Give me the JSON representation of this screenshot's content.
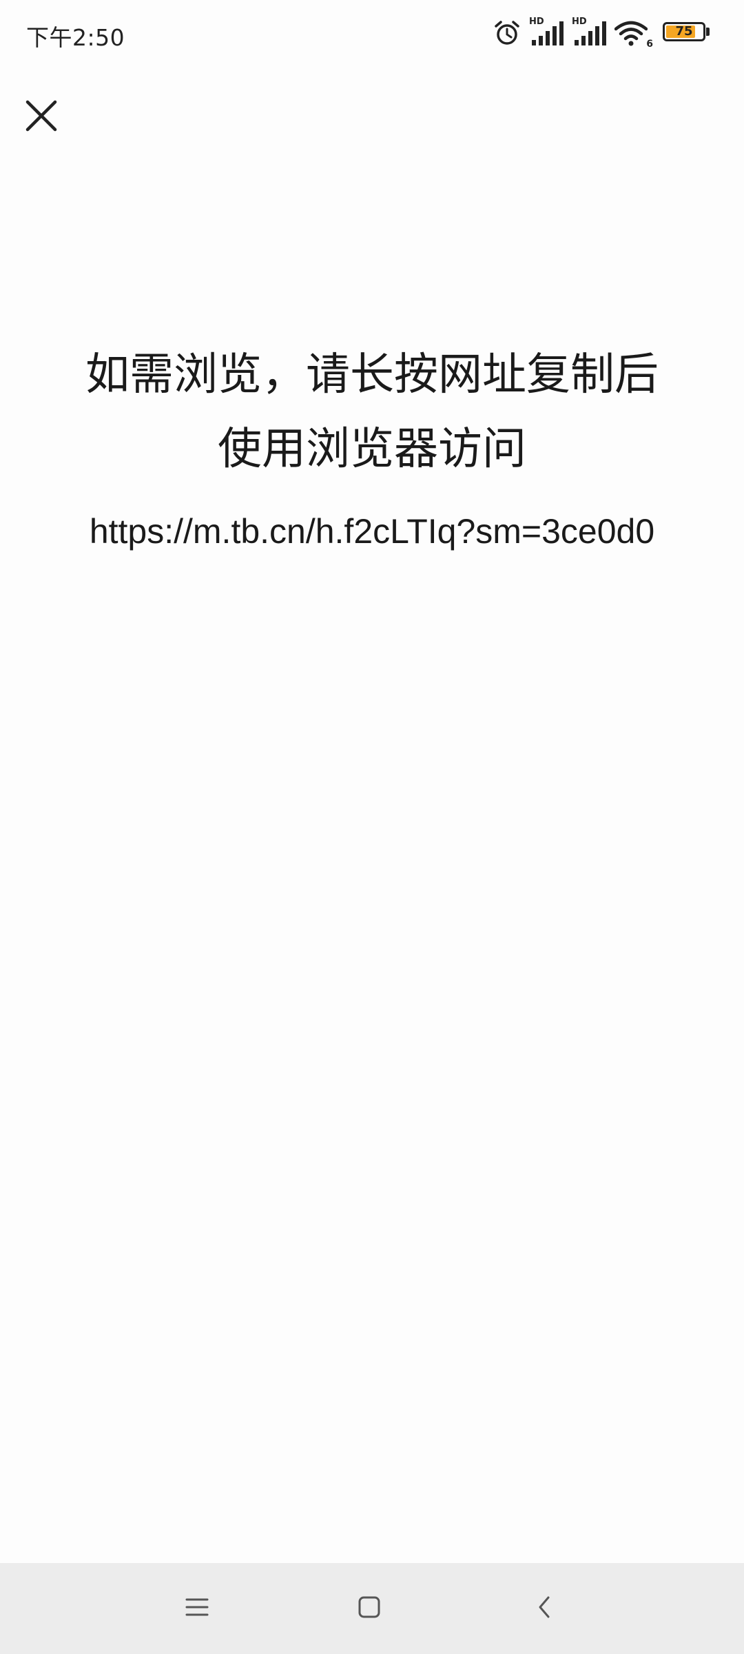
{
  "status_bar": {
    "time": "下午2:50",
    "hd_label_1": "HD",
    "hd_label_2": "HD",
    "wifi_badge": "6",
    "battery_level": "75",
    "battery_color": "#f5a623",
    "icons": [
      "alarm-icon",
      "signal-icon",
      "signal-icon",
      "wifi-icon",
      "battery-icon"
    ]
  },
  "header": {
    "close_icon": "close-icon"
  },
  "content": {
    "notice_line1": "如需浏览，请长按网址复制后",
    "notice_line2": "使用浏览器访问",
    "url": "https://m.tb.cn/h.f2cLTIq?sm=3ce0d0"
  },
  "nav_bar": {
    "icons": [
      "menu-icon",
      "home-icon",
      "back-icon"
    ]
  }
}
